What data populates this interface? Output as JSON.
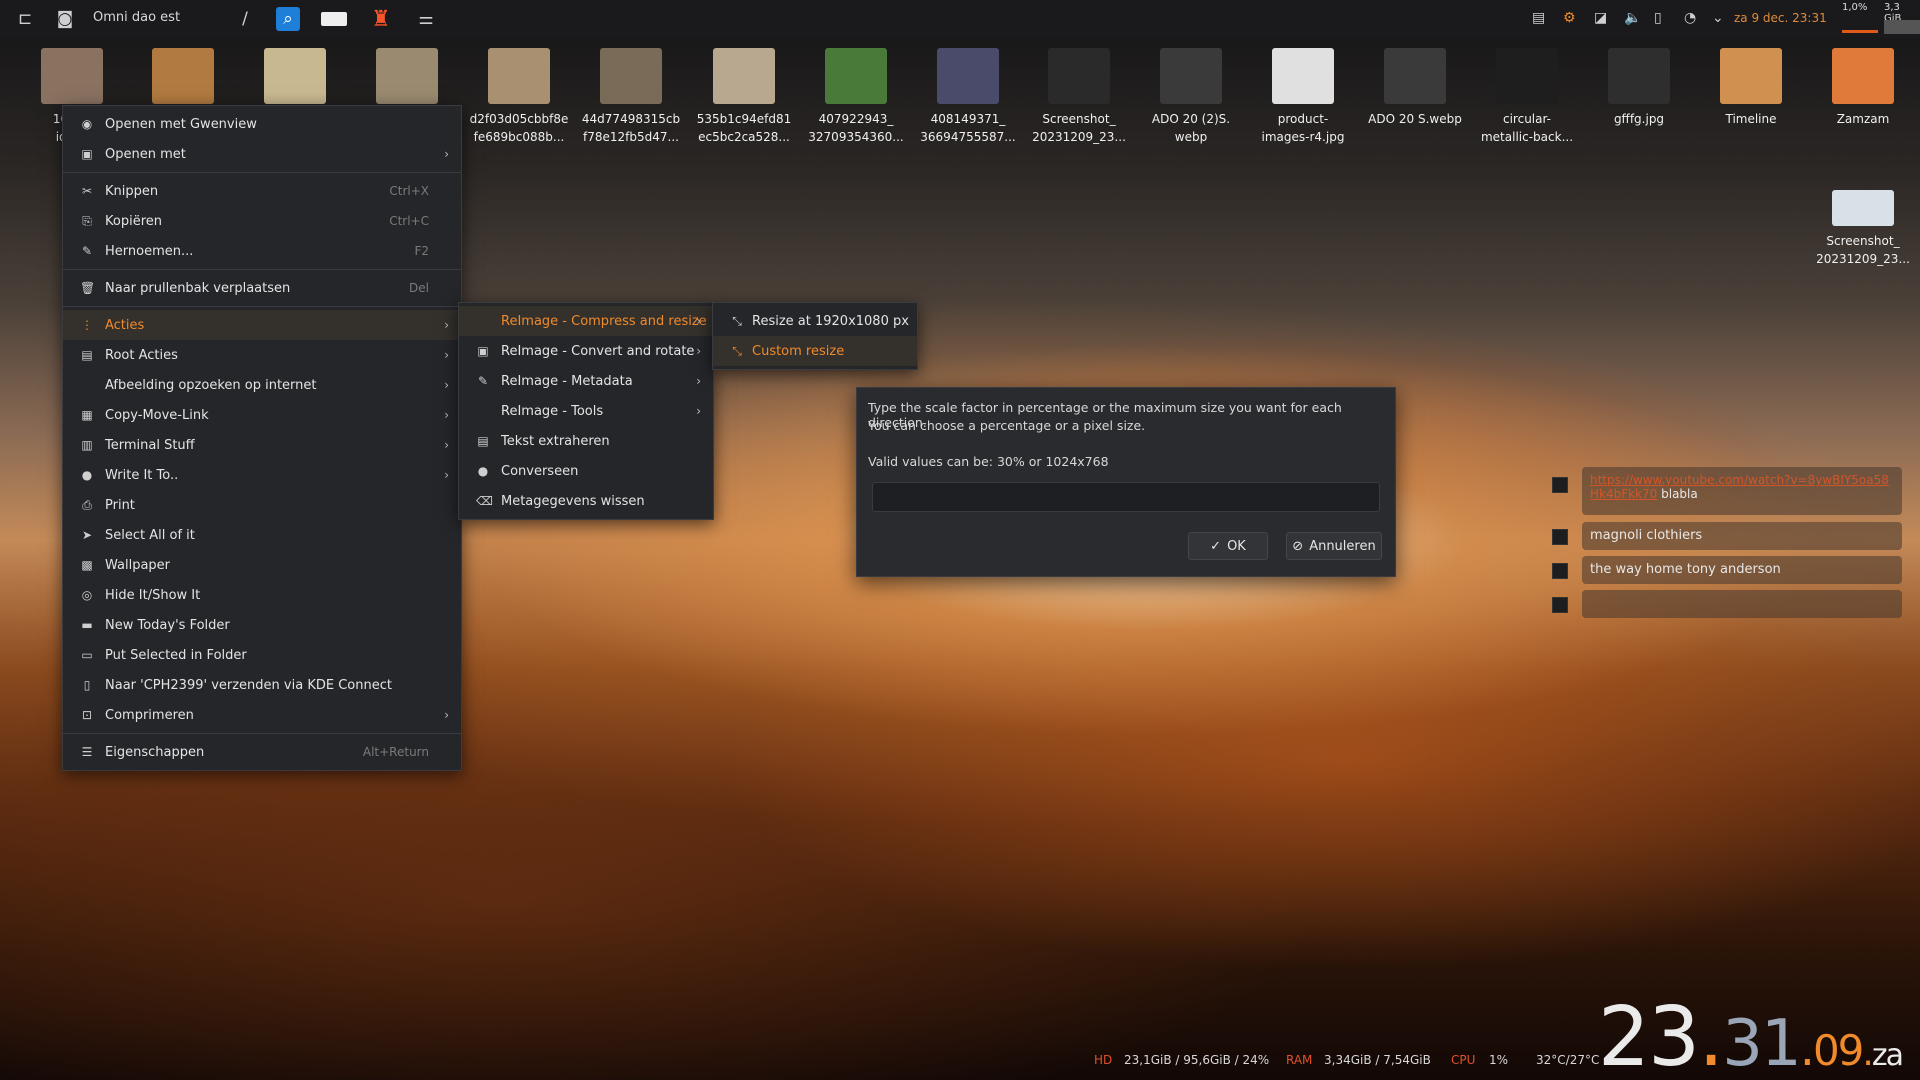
{
  "topbar": {
    "title": "Omni dao est",
    "slash": "/",
    "tray_date": "za 9 dec. 23:31",
    "cpu_pct": "1,0%",
    "mem": "3,3 GiB"
  },
  "desktop_icons": [
    {
      "label": "16794\nidei-c",
      "color": "#8a7260"
    },
    {
      "label": "",
      "color": "#b07a40"
    },
    {
      "label": "",
      "color": "#c8b890"
    },
    {
      "label": "",
      "color": "#9a8a70"
    },
    {
      "label": "d2f03d05cbbf8e\nfe689bc088b...",
      "color": "#a89070"
    },
    {
      "label": "44d77498315cb\nf78e12fb5d47...",
      "color": "#7a6a58"
    },
    {
      "label": "535b1c94efd81\nec5bc2ca528...",
      "color": "#b8a890"
    },
    {
      "label": "407922943_\n32709354360...",
      "color": "#4a7a3a"
    },
    {
      "label": "408149371_\n36694755587...",
      "color": "#4a4a6a"
    },
    {
      "label": "Screenshot_\n20231209_23...",
      "color": "#2a2a2a"
    },
    {
      "label": "ADO 20 (2)S.\nwebp",
      "color": "#3a3a3a"
    },
    {
      "label": "product-\nimages-r4.jpg",
      "color": "#e0e0e0"
    },
    {
      "label": "ADO 20 S.webp",
      "color": "#3a3a3a"
    },
    {
      "label": "circular-\nmetallic-back...",
      "color": "#1e1e1e"
    },
    {
      "label": "gfffg.jpg",
      "color": "#2e2e2e"
    },
    {
      "label": "Timeline",
      "color": "#d09050"
    },
    {
      "label": "Zamzam",
      "color": "#e07a3a"
    }
  ],
  "desktop_icon_extra": {
    "label": "Screenshot_\n20231209_23...",
    "color": "#d8e0e8"
  },
  "context_menu": {
    "items": [
      {
        "label": "Openen met Gwenview",
        "icon": "gwenview-icon",
        "glyph": "◉",
        "shortcut": "",
        "submenu": false
      },
      {
        "label": "Openen met",
        "icon": "open-with-icon",
        "glyph": "▣",
        "shortcut": "",
        "submenu": true
      },
      {
        "sep": true
      },
      {
        "label": "Knippen",
        "icon": "scissors-icon",
        "glyph": "✂",
        "shortcut": "Ctrl+X",
        "submenu": false
      },
      {
        "label": "Kopiëren",
        "icon": "copy-icon",
        "glyph": "⎘",
        "shortcut": "Ctrl+C",
        "submenu": false
      },
      {
        "label": "Hernoemen...",
        "icon": "rename-icon",
        "glyph": "✎",
        "shortcut": "F2",
        "submenu": false
      },
      {
        "sep": true
      },
      {
        "label": "Naar prullenbak verplaatsen",
        "icon": "trash-icon",
        "glyph": "🗑",
        "shortcut": "Del",
        "submenu": false
      },
      {
        "sep": true
      },
      {
        "label": "Acties",
        "icon": "actions-icon",
        "glyph": "⋮",
        "shortcut": "",
        "submenu": true,
        "highlight": true
      },
      {
        "label": "Root Acties",
        "icon": "root-icon",
        "glyph": "▤",
        "shortcut": "",
        "submenu": true
      },
      {
        "label": "Afbeelding opzoeken op internet",
        "icon": "",
        "glyph": "",
        "shortcut": "",
        "submenu": true
      },
      {
        "label": "Copy-Move-Link",
        "icon": "copy-move-icon",
        "glyph": "▦",
        "shortcut": "",
        "submenu": true
      },
      {
        "label": "Terminal Stuff",
        "icon": "terminal-icon",
        "glyph": "▥",
        "shortcut": "",
        "submenu": true
      },
      {
        "label": "Write It To..",
        "icon": "write-icon",
        "glyph": "●",
        "shortcut": "",
        "submenu": true
      },
      {
        "label": "Print",
        "icon": "printer-icon",
        "glyph": "⎙",
        "shortcut": "",
        "submenu": false
      },
      {
        "label": "Select All of it",
        "icon": "cursor-icon",
        "glyph": "➤",
        "shortcut": "",
        "submenu": false
      },
      {
        "label": "Wallpaper",
        "icon": "wallpaper-icon",
        "glyph": "▩",
        "shortcut": "",
        "submenu": false
      },
      {
        "label": "Hide It/Show It",
        "icon": "eye-icon",
        "glyph": "◎",
        "shortcut": "",
        "submenu": false
      },
      {
        "label": "New Today's Folder",
        "icon": "folder-icon",
        "glyph": "▬",
        "shortcut": "",
        "submenu": false
      },
      {
        "label": "Put Selected in Folder",
        "icon": "folder-put-icon",
        "glyph": "▭",
        "shortcut": "",
        "submenu": false
      },
      {
        "label": "Naar 'CPH2399' verzenden via KDE Connect",
        "icon": "phone-icon",
        "glyph": "▯",
        "shortcut": "",
        "submenu": false
      },
      {
        "label": "Comprimeren",
        "icon": "compress-icon",
        "glyph": "⊡",
        "shortcut": "",
        "submenu": true
      },
      {
        "sep": true
      },
      {
        "label": "Eigenschappen",
        "icon": "properties-icon",
        "glyph": "☰",
        "shortcut": "Alt+Return",
        "submenu": false
      }
    ]
  },
  "actions_submenu": {
    "items": [
      {
        "label": "ReImage - Compress and resize",
        "glyph": "",
        "icon": "",
        "submenu": true,
        "highlight": true
      },
      {
        "label": "ReImage - Convert and rotate",
        "glyph": "▣",
        "icon": "image-icon",
        "submenu": true
      },
      {
        "label": "ReImage - Metadata",
        "glyph": "✎",
        "icon": "pen-icon",
        "submenu": true
      },
      {
        "label": "ReImage - Tools",
        "glyph": "",
        "icon": "",
        "submenu": true
      },
      {
        "label": "Tekst extraheren",
        "glyph": "▤",
        "icon": "text-extract-icon",
        "submenu": false
      },
      {
        "label": "Converseen",
        "glyph": "●",
        "icon": "converseen-icon",
        "submenu": false
      },
      {
        "label": "Metagegevens wissen",
        "glyph": "⌫",
        "icon": "erase-icon",
        "submenu": false
      }
    ]
  },
  "resize_submenu": {
    "items": [
      {
        "label": "Resize at 1920x1080 px",
        "glyph": "⤡",
        "icon": "resize-icon",
        "highlight": false
      },
      {
        "label": "Custom resize",
        "glyph": "⤡",
        "icon": "custom-resize-icon",
        "highlight": true
      }
    ]
  },
  "dialog": {
    "line1": "Type the scale factor in percentage or the maximum size you want for each direction.",
    "line2": "You can choose a percentage or a pixel size.",
    "valid": "Valid values can be: 30% or 1024x768",
    "input_value": "",
    "ok": "OK",
    "cancel": "Annuleren"
  },
  "todos": [
    {
      "link": "https://www.youtube.com/watch?v=8ywBIY5oa58Hk4bFkk70",
      "text": "blabla"
    },
    {
      "link": "",
      "text": "magnoli clothiers"
    },
    {
      "link": "",
      "text": "the way home tony anderson"
    },
    {
      "link": "",
      "text": ""
    }
  ],
  "sysbar": {
    "hd_label": "HD",
    "hd_value": "23,1GiB / 95,6GiB / 24%",
    "ram_label": "RAM",
    "ram_value": "3,34GiB / 7,54GiB",
    "cpu_label": "CPU",
    "cpu_value": "1%",
    "temp": "32°C/27°C"
  },
  "bigclock": {
    "h": "23",
    "sep1": ".",
    "m": "31",
    "sep2": ".",
    "day": "09",
    "sep3": ".",
    "wd": "za"
  },
  "colors": {
    "accent": "#f08a2a",
    "panel": "#25262a"
  }
}
